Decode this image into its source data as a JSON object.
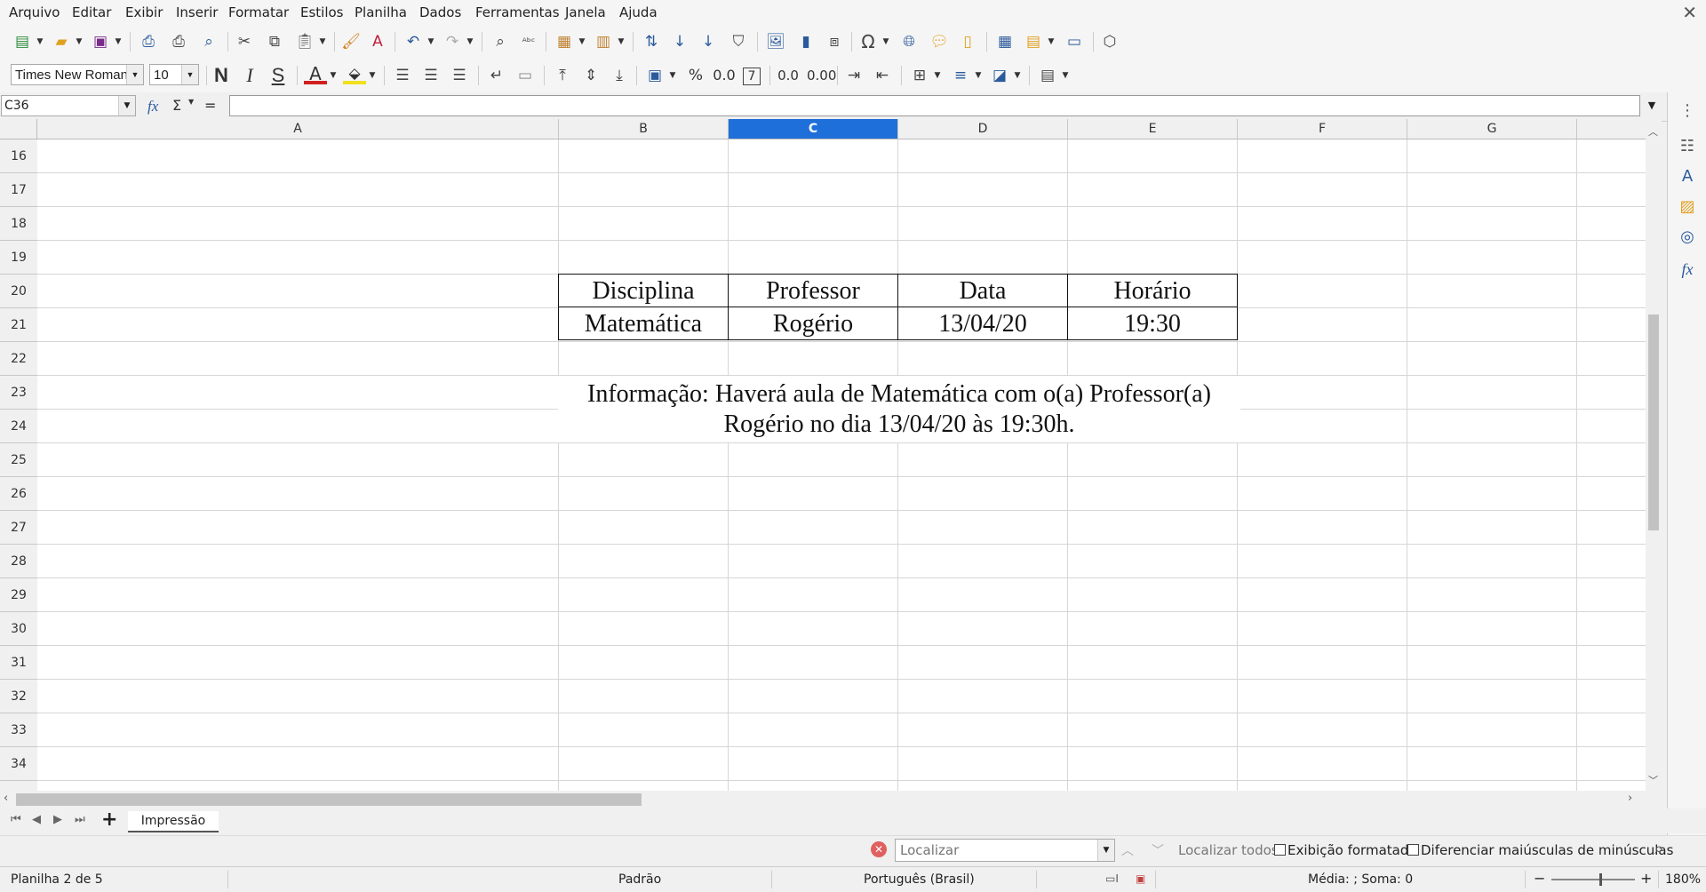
{
  "menu": [
    "Arquivo",
    "Editar",
    "Exibir",
    "Inserir",
    "Formatar",
    "Estilos",
    "Planilha",
    "Dados",
    "Ferramentas",
    "Janela",
    "Ajuda"
  ],
  "toolbar": {
    "font_name": "Times New Roman",
    "font_size": "10",
    "bold_label": "N",
    "italic_label": "I",
    "strike_label": "S",
    "percent_label": "%",
    "decimal_label": "0.0",
    "decimals_label": "0.00"
  },
  "formula_bar": {
    "name_box": "C36",
    "fx_label": "fx",
    "sum_label": "Σ",
    "equals_label": "=",
    "value": ""
  },
  "columns": [
    "A",
    "B",
    "C",
    "D",
    "E",
    "F",
    "G"
  ],
  "selected_column": "C",
  "rows": [
    "16",
    "17",
    "18",
    "19",
    "20",
    "21",
    "22",
    "23",
    "24",
    "25",
    "26",
    "27",
    "28",
    "29",
    "30",
    "31",
    "32",
    "33",
    "34"
  ],
  "table": {
    "headers": [
      "Disciplina",
      "Professor",
      "Data",
      "Horário"
    ],
    "values": [
      "Matemática",
      "Rogério",
      "13/04/20",
      "19:30"
    ]
  },
  "info_text": "Informação: Haverá aula de Matemática com o(a) Professor(a) Rogério no dia 13/04/20 às 19:30h.",
  "sheet_tab": "Impressão",
  "find": {
    "placeholder": "Localizar",
    "find_all": "Localizar todos",
    "formatted_display": "Exibição formatada",
    "match_case": "Diferenciar maiúsculas de minúsculas"
  },
  "status": {
    "sheet": "Planilha 2 de 5",
    "style": "Padrão",
    "language": "Português (Brasil)",
    "summary": "Média: ; Soma: 0",
    "zoom": "180%"
  }
}
